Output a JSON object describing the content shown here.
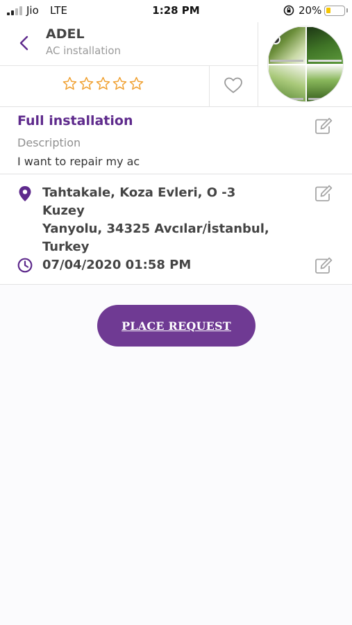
{
  "status_bar": {
    "carrier": "Jio",
    "network": "LTE",
    "time": "1:28 PM",
    "battery_percent": "20%",
    "battery_color": "#f5c400"
  },
  "header": {
    "back_icon": "chevron-left-icon",
    "provider_name": "ADEL",
    "provider_service": "AC installation",
    "rating": 0,
    "rating_max": 5,
    "star_color": "#f0a030",
    "favorite_icon": "heart-outline-icon"
  },
  "details": {
    "service_type": "Full installation",
    "description_label": "Description",
    "description_text": "I want to repair my ac"
  },
  "location": {
    "address_line_1": "Tahtakale, Koza Evleri, O -3 Kuzey",
    "address_line_2": "Yanyolu, 34325 Avcılar/İstanbul,",
    "address_line_3": "Turkey",
    "datetime": "07/04/2020 01:58 PM"
  },
  "actions": {
    "place_request_label": "PLACE REQUEST"
  },
  "colors": {
    "accent": "#6f3a93",
    "title_purple": "#5e2a8c",
    "icon_gray": "#a6a6a6"
  }
}
